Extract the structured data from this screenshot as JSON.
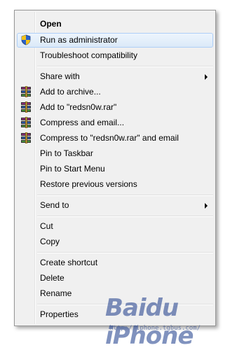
{
  "context_menu": {
    "items": [
      {
        "label": "Open",
        "icon": "",
        "bold": true
      },
      {
        "label": "Run as administrator",
        "icon": "uac-shield-icon",
        "highlighted": true
      },
      {
        "label": "Troubleshoot compatibility",
        "icon": ""
      },
      {
        "label": "Share with",
        "icon": "",
        "submenu": true
      },
      {
        "label": "Add to archive...",
        "icon": "winrar-icon"
      },
      {
        "label": "Add to \"redsn0w.rar\"",
        "icon": "winrar-icon"
      },
      {
        "label": "Compress and email...",
        "icon": "winrar-icon"
      },
      {
        "label": "Compress to \"redsn0w.rar\" and email",
        "icon": "winrar-icon"
      },
      {
        "label": "Pin to Taskbar",
        "icon": ""
      },
      {
        "label": "Pin to Start Menu",
        "icon": ""
      },
      {
        "label": "Restore previous versions",
        "icon": ""
      },
      {
        "label": "Send to",
        "icon": "",
        "submenu": true
      },
      {
        "label": "Cut",
        "icon": ""
      },
      {
        "label": "Copy",
        "icon": ""
      },
      {
        "label": "Create shortcut",
        "icon": ""
      },
      {
        "label": "Delete",
        "icon": ""
      },
      {
        "label": "Rename",
        "icon": ""
      },
      {
        "label": "Properties",
        "icon": ""
      }
    ]
  },
  "watermark": {
    "brand": "Baidu iPhone",
    "url": "http://iphone.tgbus.com/"
  },
  "colors": {
    "menu_bg": "#f0f0f0",
    "highlight_border": "#aecff7",
    "shield_blue": "#2a62c9",
    "shield_yellow": "#f2c21b"
  }
}
